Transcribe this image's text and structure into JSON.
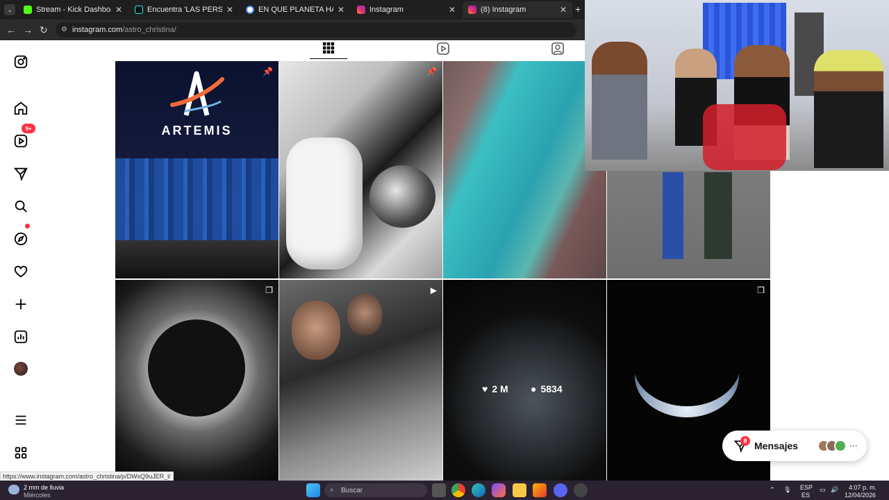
{
  "browser": {
    "tabs": [
      {
        "title": "Stream - Kick Dashboard",
        "favicon_color": "#53fc18"
      },
      {
        "title": "Encuentra 'LAS PERSONAS SAL",
        "favicon_color": "#000000"
      },
      {
        "title": "EN QUE PLANETA HAY ADMOS",
        "favicon_color": "#4285f4"
      },
      {
        "title": "Instagram",
        "favicon_color": "#e1306c"
      },
      {
        "title": "(8) Instagram",
        "favicon_color": "#e1306c"
      }
    ],
    "url_host": "instagram.com",
    "url_path": "/astro_christina/"
  },
  "sidebar": {
    "items": [
      {
        "name": "instagram-logo-icon"
      },
      {
        "name": "home-icon"
      },
      {
        "name": "reels-icon"
      },
      {
        "name": "messages-icon"
      },
      {
        "name": "search-icon"
      },
      {
        "name": "explore-icon"
      },
      {
        "name": "notifications-icon"
      },
      {
        "name": "create-icon"
      },
      {
        "name": "dashboard-icon"
      },
      {
        "name": "profile-avatar"
      },
      {
        "name": "more-menu-icon"
      },
      {
        "name": "also-from-meta-icon"
      }
    ],
    "messages_badge": "9+"
  },
  "grid": {
    "post_1": {
      "logo_text": "ARTEMIS"
    },
    "hover_stats": {
      "likes": "2 M",
      "comments": "5834"
    }
  },
  "messages_bar": {
    "label": "Mensajes",
    "badge": "8"
  },
  "status_url": "https://www.instagram.com/astro_christina/p/DWxQ9uJER_l/",
  "taskbar": {
    "weather_main": "2 mm de lluvia",
    "weather_sub": "Miércoles",
    "search_placeholder": "Buscar",
    "lang": "ESP",
    "lang_sub": "ES",
    "time": "4:07 p. m.",
    "date": "12/04/2026"
  }
}
